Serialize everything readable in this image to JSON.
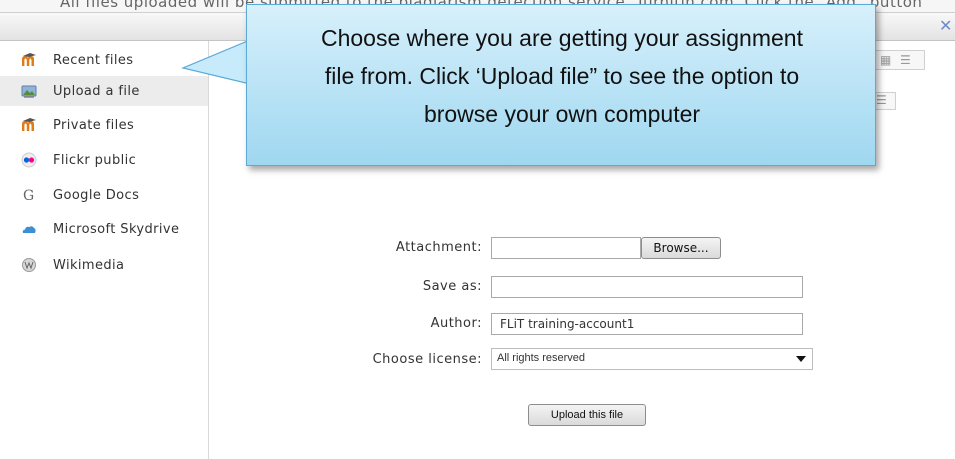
{
  "background": {
    "text": "All files uploaded will be submitted to the plagiarism detection service. Turnitin.com. Click the “Add” button"
  },
  "sidebar": {
    "items": [
      {
        "label": "Recent files",
        "icon": "moodle-icon"
      },
      {
        "label": "Upload a file",
        "icon": "upload-icon"
      },
      {
        "label": "Private files",
        "icon": "moodle-icon"
      },
      {
        "label": "Flickr public",
        "icon": "flickr-icon"
      },
      {
        "label": "Google Docs",
        "icon": "google-icon"
      },
      {
        "label": "Microsoft Skydrive",
        "icon": "skydrive-icon"
      },
      {
        "label": "Wikimedia",
        "icon": "wikimedia-icon"
      }
    ]
  },
  "form": {
    "attachment_label": "Attachment:",
    "browse_label": "Browse...",
    "save_as_label": "Save as:",
    "save_as_value": "",
    "author_label": "Author:",
    "author_value": "FLiT training-account1",
    "license_label": "Choose license:",
    "license_value": "All rights reserved",
    "upload_label": "Upload this file"
  },
  "callout": {
    "line1": "Choose where you are getting your assignment",
    "line2": "file from. Click ‘Upload file” to see the option to",
    "line3": "browse your own computer"
  },
  "colors": {
    "callout_top": "#d7f0fb",
    "callout_bottom": "#9fd7f0",
    "callout_border": "#5aa9d6",
    "active_item": "#ececec"
  }
}
